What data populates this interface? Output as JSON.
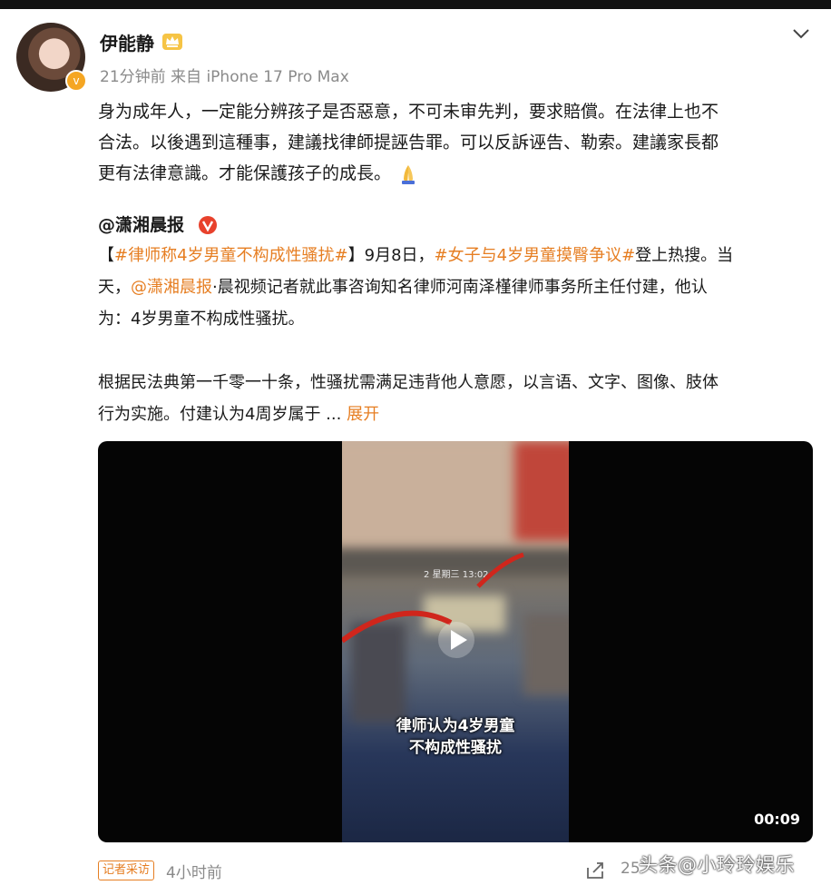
{
  "post": {
    "user_name": "伊能静",
    "meta": "21分钟前  来自 iPhone 17 Pro Max",
    "body_lines": [
      "身为成年人，一定能分辨孩子是否惡意，不可未审先判，要求賠償。在法律上也不",
      "合法。以後遇到這種事，建議找律師提誣告罪。可以反訴诬告、勒索。建議家長都",
      "更有法律意識。才能保護孩子的成長。"
    ],
    "icons": {
      "crown": "crown-icon",
      "more": "chevron-down-icon",
      "emoji": "pray-emoji"
    }
  },
  "repost": {
    "author": "@潇湘晨报",
    "line1_a": "【",
    "line1_topic1": "#律师称4岁男童不构成性骚扰#",
    "line1_b": "】9月8日，",
    "line1_topic2": "#女子与4岁男童摸臀争议#",
    "line1_c": "登上热搜。当",
    "line2_a": "天，",
    "line2_mention": "@潇湘晨报",
    "line2_b": "·晨视频记者就此事咨询知名律师河南泽槿律师事务所主任付建，他认",
    "line3": "为：4岁男童不构成性骚扰。",
    "para2_line1": "根据民法典第一千零一十条，性骚扰需满足违背他人意愿，以言语、文字、图像、肢体",
    "para2_line2": "行为实施。付建认为4周岁属于  ...",
    "expand": "展开"
  },
  "video": {
    "caption_line1": "律师认为4岁男童",
    "caption_line2": "不构成性骚扰",
    "duration": "00:09",
    "overlay_text": "2 星期三 13:02"
  },
  "footer": {
    "badge": "记者采访",
    "time": "4小时前",
    "counts": "25",
    "watermark": "头条@小玲玲娱乐"
  },
  "colors": {
    "link": "#e67e22",
    "meta": "#8a8a8a",
    "verified": "#e8412c"
  }
}
